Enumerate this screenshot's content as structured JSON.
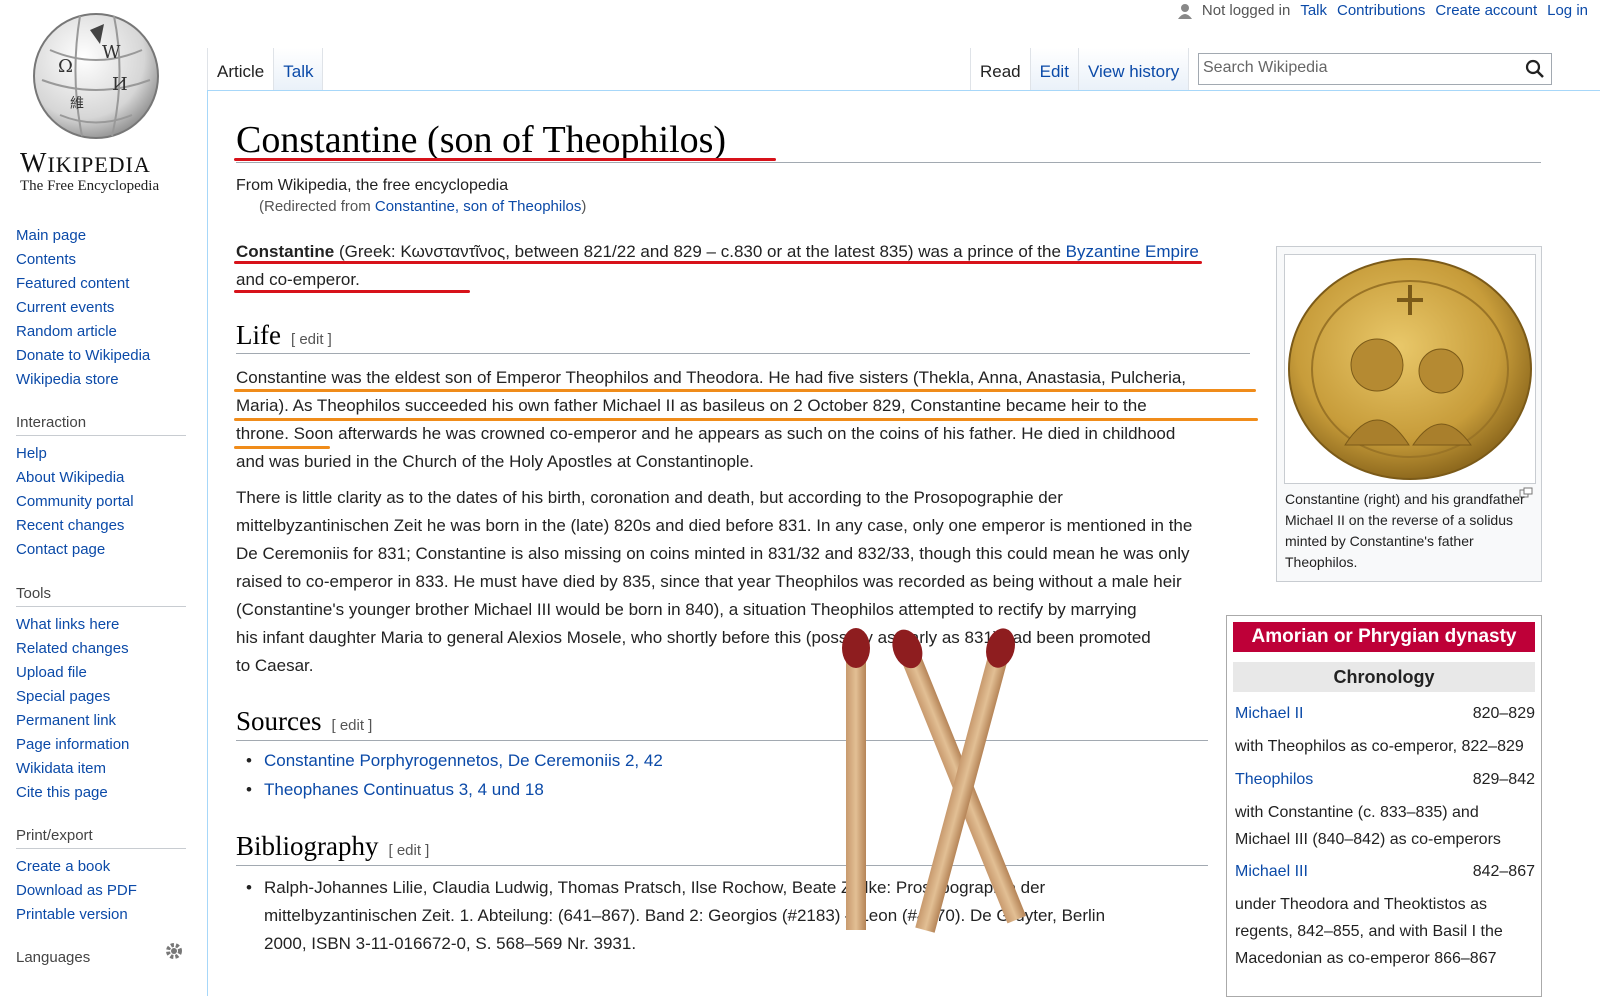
{
  "site": {
    "wordmark": "Wikipedia",
    "tagline": "The Free Encyclopedia"
  },
  "topbar": {
    "not_logged": "Not logged in",
    "talk": "Talk",
    "contributions": "Contributions",
    "create": "Create account",
    "login": "Log in"
  },
  "tabs": {
    "article": "Article",
    "talk": "Talk",
    "read": "Read",
    "edit": "Edit",
    "history": "View history"
  },
  "search": {
    "placeholder": "Search Wikipedia"
  },
  "nav": {
    "main": [
      "Main page",
      "Contents",
      "Featured content",
      "Current events",
      "Random article",
      "Donate to Wikipedia",
      "Wikipedia store"
    ],
    "interaction_hd": "Interaction",
    "interaction": [
      "Help",
      "About Wikipedia",
      "Community portal",
      "Recent changes",
      "Contact page"
    ],
    "tools_hd": "Tools",
    "tools": [
      "What links here",
      "Related changes",
      "Upload file",
      "Special pages",
      "Permanent link",
      "Page information",
      "Wikidata item",
      "Cite this page"
    ],
    "print_hd": "Print/export",
    "print": [
      "Create a book",
      "Download as PDF",
      "Printable version"
    ],
    "lang_hd": "Languages"
  },
  "article": {
    "title": "Constantine (son of Theophilos)",
    "from": "From Wikipedia, the free encyclopedia",
    "redirect_pre": "(Redirected from ",
    "redirect_link": "Constantine, son of Theophilos",
    "redirect_post": ")",
    "lead": {
      "b": "Constantine",
      "l1": "(Greek: Κωνσταντῖνος, between 821/22 and 829 – c.830 or at the latest 835) was a prince of the ",
      "link": "Byzantine Empire",
      "l2": " and co-emperor."
    },
    "life_h": "Life",
    "edit": "[ edit ]",
    "life_p1": [
      "Constantine was the eldest son of Emperor Theophilos and Theodora. He had five sisters (Thekla, Anna, Anastasia, Pulcheria,",
      "Maria). As Theophilos succeeded his own father Michael II as basileus on 2 October 829, Constantine became heir to the",
      "throne. Soon afterwards he was crowned co-emperor and he appears as such on the coins of his father. He died in childhood",
      "and was buried in the Church of the Holy Apostles at Constantinople."
    ],
    "life_p2": [
      "There is little clarity as to the dates of his birth, coronation and death, but according to the Prosopographie der",
      "mittelbyzantinischen Zeit he was born in the (late) 820s and died before 831. In any case, only one emperor is mentioned in the",
      "De Ceremoniis for 831; Constantine is also missing on coins minted in 831/32 and 832/33, though this could mean he was only",
      "raised to co-emperor in 833. He must have died by 835, since that year Theophilos was recorded as being without a male heir",
      "(Constantine's younger brother Michael III would be born in 840), a situation Theophilos attempted to rectify by marrying",
      "his infant daughter Maria to general Alexios Mosele, who shortly before this (possibly as early as 831) had been promoted",
      "to Caesar."
    ],
    "sources_h": "Sources",
    "sources": [
      "Constantine Porphyrogennetos, De Ceremoniis 2, 42",
      "Theophanes Continuatus 3, 4 und 18"
    ],
    "biblio_h": "Bibliography",
    "biblio": [
      "Ralph-Johannes Lilie, Claudia Ludwig, Thomas Pratsch, Ilse Rochow, Beate Zielke: Prosopographie der",
      "mittelbyzantinischen Zeit. 1. Abteilung: (641–867). Band 2: Georgios (#2183) – Leon (#4270). De Gruyter, Berlin",
      "2000, ISBN 3-11-016672-0, S. 568–569 Nr. 3931."
    ]
  },
  "thumb": {
    "caption": "Constantine (right) and his grandfather Michael II on the reverse of a solidus minted by Constantine's father Theophilos."
  },
  "navbox": {
    "title": "Amorian or Phrygian dynasty",
    "chron": "Chronology",
    "rows": [
      {
        "l": "Michael II",
        "r": "820–829"
      },
      {
        "l": "with Theophilos as co-emperor, 822–829",
        "r": ""
      },
      {
        "l": "Theophilos",
        "r": "829–842"
      },
      {
        "l": "with Constantine (c. 833–835) and",
        "r": ""
      },
      {
        "l": "Michael III (840–842) as co-emperors",
        "r": ""
      },
      {
        "l": "Michael III",
        "r": "842–867"
      },
      {
        "l": "under Theodora and Theoktistos as",
        "r": ""
      },
      {
        "l": "regents, 842–855, and with Basil I the",
        "r": ""
      },
      {
        "l": "Macedonian as co-emperor 866–867",
        "r": ""
      }
    ]
  },
  "colors": {
    "link": "#0b4aa8",
    "underline_red": "#d7121a",
    "underline_orange": "#f08c1a",
    "navbox_header": "#be0038"
  }
}
